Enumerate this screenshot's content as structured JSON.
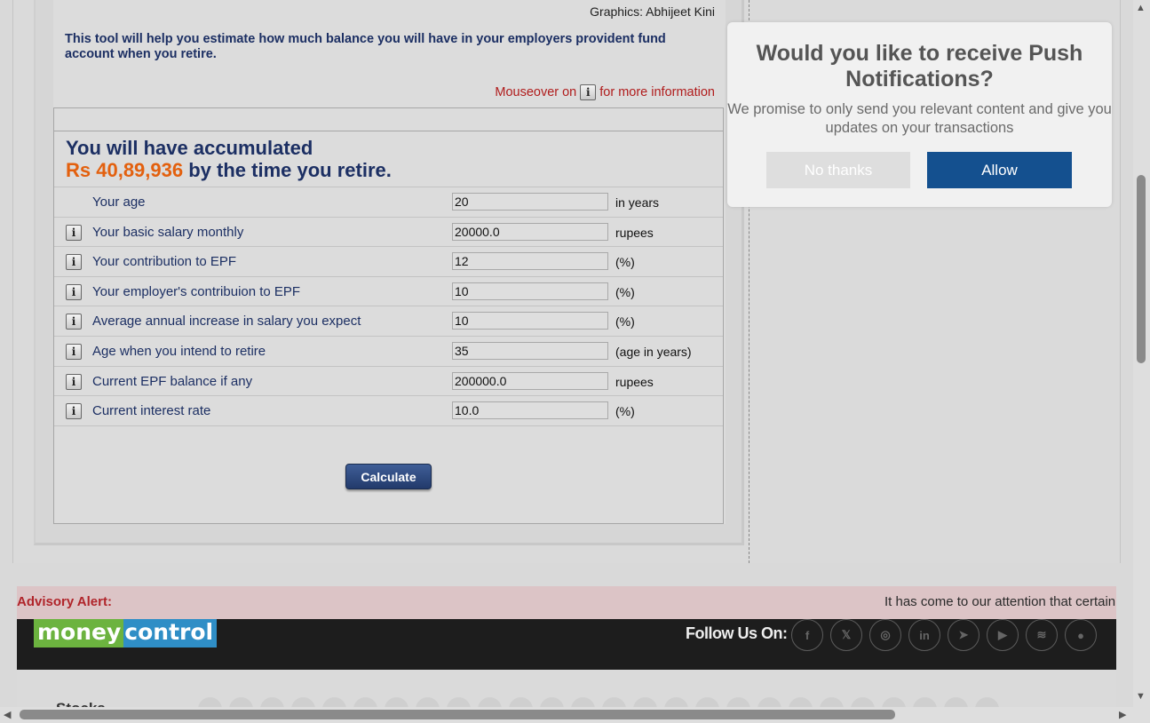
{
  "calculator": {
    "credit": "Graphics: Abhijeet Kini",
    "intro": "This tool will help you estimate how much balance you will have in your employers provident fund account when you retire.",
    "mouseover_prefix": "Mouseover on",
    "mouseover_suffix": "for more information",
    "result_line1": "You will have accumulated",
    "result_amount": "Rs 40,89,936",
    "result_suffix": "by the time you retire.",
    "info_glyph": "i",
    "rows": [
      {
        "label": "Your age",
        "value": "20",
        "unit": "in years",
        "info": false
      },
      {
        "label": "Your basic salary monthly",
        "value": "20000.0",
        "unit": "rupees",
        "info": true
      },
      {
        "label": "Your contribution to EPF",
        "value": "12",
        "unit": "(%)",
        "info": true
      },
      {
        "label": "Your employer's contribuion to EPF",
        "value": "10",
        "unit": "(%)",
        "info": true
      },
      {
        "label": "Average annual increase in salary you expect",
        "value": "10",
        "unit": "(%)",
        "info": true
      },
      {
        "label": "Age when you intend to retire",
        "value": "35",
        "unit": "(age in years)",
        "info": true
      },
      {
        "label": "Current EPF balance if any",
        "value": "200000.0",
        "unit": "rupees",
        "info": true
      },
      {
        "label": "Current interest rate",
        "value": "10.0",
        "unit": "(%)",
        "info": true
      }
    ],
    "calculate_label": "Calculate"
  },
  "push": {
    "title": "Would you like to receive Push Notifications?",
    "description": "We promise to only send you relevant content and give you updates on your transactions",
    "no_label": "No thanks",
    "allow_label": "Allow"
  },
  "advisory": {
    "label": "Advisory Alert:",
    "text": "It has come to our attention that certain ind"
  },
  "footer": {
    "logo_part1": "money",
    "logo_part2": "control",
    "follow_label": "Follow Us On:",
    "socials": [
      {
        "name": "facebook-icon",
        "glyph": "f"
      },
      {
        "name": "x-icon",
        "glyph": "𝕏"
      },
      {
        "name": "instagram-icon",
        "glyph": "◎"
      },
      {
        "name": "linkedin-icon",
        "glyph": "in"
      },
      {
        "name": "telegram-icon",
        "glyph": "➤"
      },
      {
        "name": "youtube-icon",
        "glyph": "▶"
      },
      {
        "name": "rss-icon",
        "glyph": "≋"
      },
      {
        "name": "chat-icon",
        "glyph": "●"
      }
    ],
    "stocks_label": "Stocks"
  },
  "colors": {
    "accent_orange": "#e3600e",
    "navy_text": "#1c2f63",
    "allow_blue": "#14508f",
    "advisory_red": "#b0242a"
  }
}
